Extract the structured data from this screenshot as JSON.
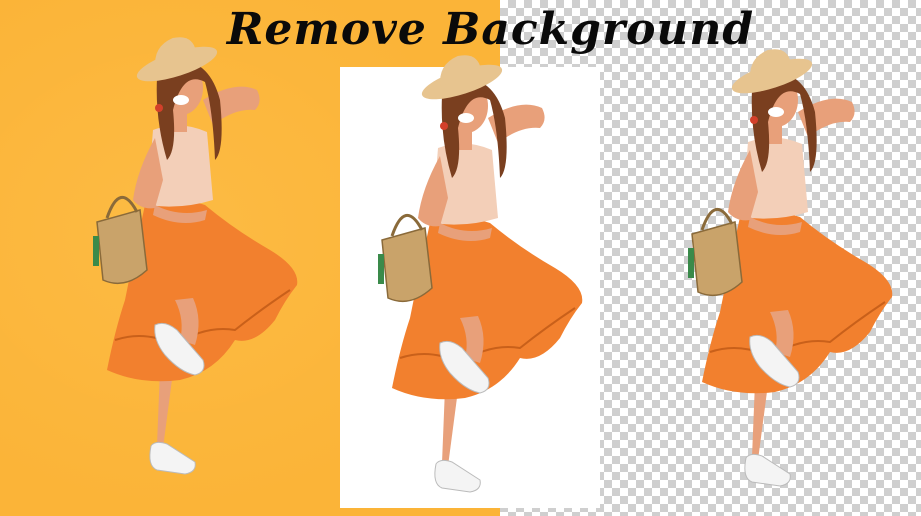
{
  "title": "Remove Background",
  "colors": {
    "orange_bg": "#fbb438",
    "checker_light": "#ffffff",
    "checker_dark": "#cfcfcf",
    "skirt": "#f2802e",
    "skin": "#e8a07a",
    "hair": "#7a3f1f",
    "hat": "#e7c48f",
    "top": "#f3cfb8",
    "shoes": "#f4f4f4"
  }
}
